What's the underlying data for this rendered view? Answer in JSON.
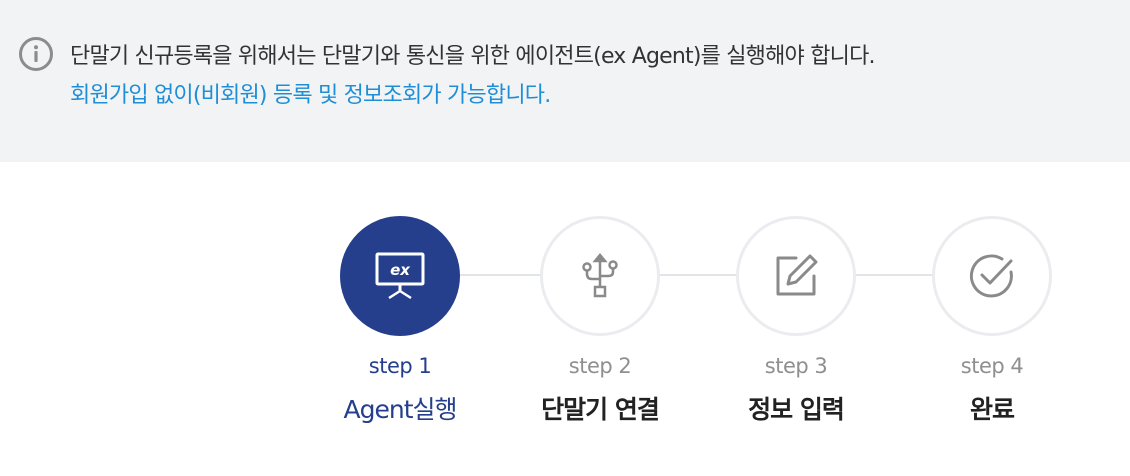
{
  "notice": {
    "icon": "info-icon",
    "line1": "단말기 신규등록을 위해서는 단말기와 통신을 위한 에이전트(ex Agent)를 실행해야 합니다.",
    "line2": "회원가입 없이(비회원) 등록 및 정보조회가 가능합니다."
  },
  "colors": {
    "active": "#263f8c",
    "link_text": "#1e8fd6",
    "inactive_icon": "#8a8a8a",
    "notice_bg": "#f2f3f5"
  },
  "steps": [
    {
      "label": "step 1",
      "title": "Agent실행",
      "icon": "monitor-ex-icon",
      "active": true
    },
    {
      "label": "step 2",
      "title": "단말기 연결",
      "icon": "usb-icon",
      "active": false
    },
    {
      "label": "step 3",
      "title": "정보 입력",
      "icon": "edit-icon",
      "active": false
    },
    {
      "label": "step 4",
      "title": "완료",
      "icon": "check-circle-icon",
      "active": false
    }
  ]
}
